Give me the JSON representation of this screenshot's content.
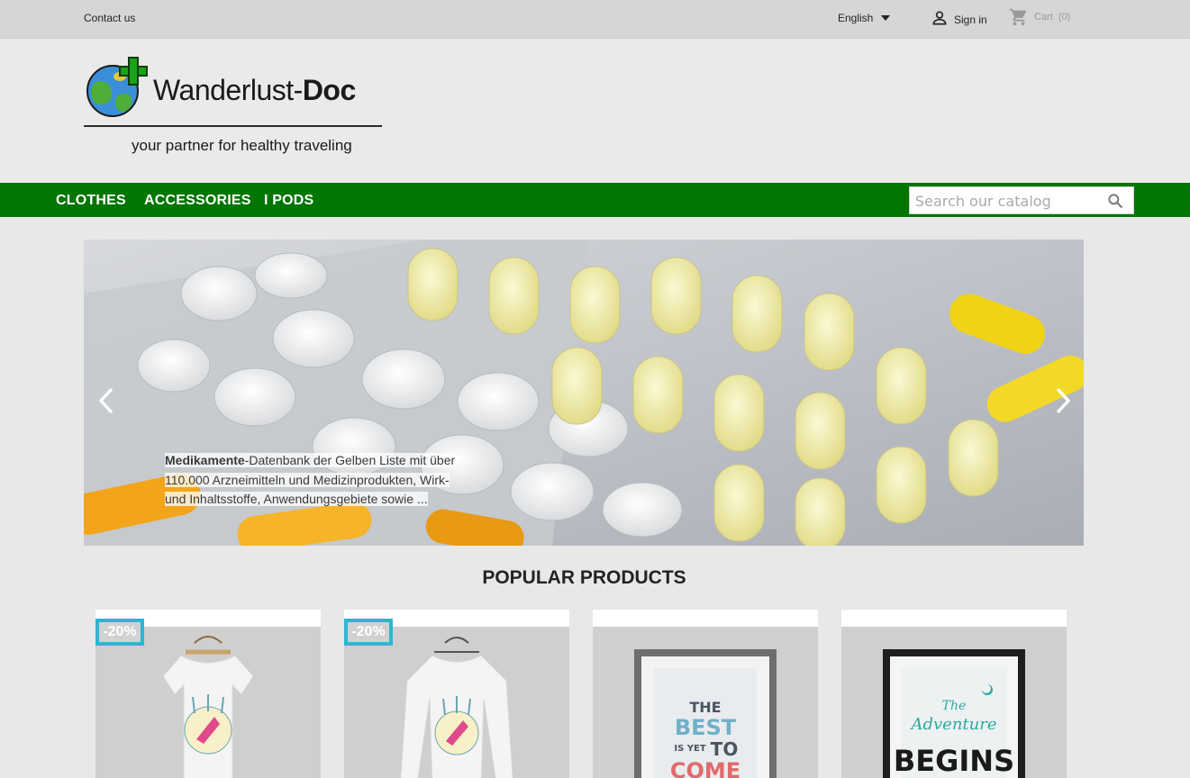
{
  "topbar": {
    "contact_label": "Contact us",
    "language": "English",
    "signin_label": "Sign in",
    "cart_label": "Cart",
    "cart_count": "(0)"
  },
  "logo": {
    "name_part1": "Wanderlust-",
    "name_part2": "Doc",
    "tagline": "your partner for healthy traveling"
  },
  "nav": {
    "items": [
      {
        "label": "CLOTHES"
      },
      {
        "label": "ACCESSORIES"
      },
      {
        "label": "I PODS"
      }
    ],
    "search_placeholder": "Search our catalog"
  },
  "slider": {
    "caption_bold": "Medikamente",
    "caption_rest": "-Datenbank der Gelben Liste mit über 110.000 Arzneimitteln und Medizinprodukten, Wirk- und Inhaltsstoffe, Anwendungsgebiete sowie ..."
  },
  "popular": {
    "title": "POPULAR PRODUCTS",
    "products": [
      {
        "badge": "-20%",
        "image": "tshirt-hummingbird"
      },
      {
        "badge": "-20%",
        "image": "sweater-hummingbird"
      },
      {
        "badge": "",
        "image": "poster-best-is-yet-to-come"
      },
      {
        "badge": "",
        "image": "poster-adventure-begins"
      }
    ],
    "poster1_lines": [
      "THE",
      "BEST",
      "IS YET",
      "TO",
      "COME"
    ],
    "poster2_lines": [
      "The",
      "Adventure",
      "BEGINS"
    ]
  },
  "colors": {
    "nav_green": "#027502",
    "badge_blue": "#2fb5d2",
    "topbar_gray": "#d6d6d6"
  }
}
